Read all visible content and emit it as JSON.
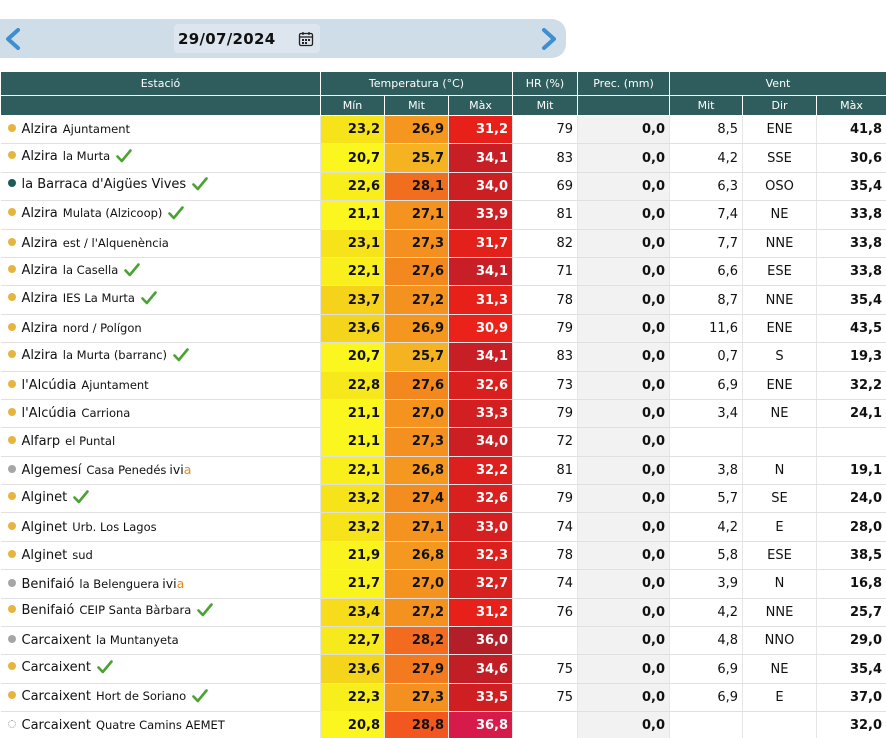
{
  "date_nav": {
    "date": "29/07/2024",
    "prev_icon": "chevron-left-icon",
    "next_icon": "chevron-right-icon",
    "calendar_icon": "calendar-icon"
  },
  "headers": {
    "station": "Estació",
    "temperature": "Temperatura (°C)",
    "humidity": "HR (%)",
    "precip": "Prec. (mm)",
    "wind": "Vent",
    "t_min": "Mín",
    "t_mit": "Mit",
    "t_max": "Màx",
    "hr_mit": "Mit",
    "w_mit": "Mit",
    "w_dir": "Dir",
    "w_max": "Màx"
  },
  "colors": {
    "header_bg": "#2f5d5d",
    "dot_orange": "#e8b440",
    "dot_teal": "#1e5a5a",
    "dot_gray": "#a6a6a6",
    "check_green": "#4aa233"
  },
  "rows": [
    {
      "name": "Alzira",
      "sub": "Ajuntament",
      "dot": "orange",
      "check": false,
      "ivia": false,
      "tmin": "23,2",
      "tmit": "26,9",
      "tmax": "31,2",
      "hr": "79",
      "prec": "0,0",
      "wmit": "8,5",
      "wdir": "ENE",
      "wmax": "41,8",
      "c": [
        "#f7e31a",
        "#f5961f",
        "#e8201a"
      ]
    },
    {
      "name": "Alzira",
      "sub": "la Murta",
      "dot": "orange",
      "check": true,
      "ivia": false,
      "tmin": "20,7",
      "tmit": "25,7",
      "tmax": "34,1",
      "hr": "83",
      "prec": "0,0",
      "wmit": "4,2",
      "wdir": "SSE",
      "wmax": "30,6",
      "c": [
        "#fbf71e",
        "#f6b321",
        "#c81e25"
      ]
    },
    {
      "name": "la Barraca d'Aigües Vives",
      "sub": "",
      "dot": "teal",
      "check": true,
      "ivia": false,
      "tmin": "22,6",
      "tmit": "28,1",
      "tmax": "34,0",
      "hr": "69",
      "prec": "0,0",
      "wmit": "6,3",
      "wdir": "OSO",
      "wmax": "35,4",
      "c": [
        "#f7ee1c",
        "#f26e1f",
        "#cb1f24"
      ]
    },
    {
      "name": "Alzira",
      "sub": "Mulata (Alzicoop)",
      "dot": "orange",
      "check": true,
      "ivia": false,
      "tmin": "21,1",
      "tmit": "27,1",
      "tmax": "33,9",
      "hr": "81",
      "prec": "0,0",
      "wmit": "7,4",
      "wdir": "NE",
      "wmax": "33,8",
      "c": [
        "#fbf71e",
        "#f4931f",
        "#cd1f24"
      ]
    },
    {
      "name": "Alzira",
      "sub": "est / l'Alquenència",
      "dot": "orange",
      "check": false,
      "ivia": false,
      "tmin": "23,1",
      "tmit": "27,3",
      "tmax": "31,7",
      "hr": "82",
      "prec": "0,0",
      "wmit": "7,7",
      "wdir": "NNE",
      "wmax": "33,8",
      "c": [
        "#f7e31a",
        "#f4901f",
        "#e4201b"
      ]
    },
    {
      "name": "Alzira",
      "sub": "la Casella",
      "dot": "orange",
      "check": true,
      "ivia": false,
      "tmin": "22,1",
      "tmit": "27,6",
      "tmax": "34,1",
      "hr": "71",
      "prec": "0,0",
      "wmit": "6,6",
      "wdir": "ESE",
      "wmax": "33,8",
      "c": [
        "#f8ef1c",
        "#f3881f",
        "#c81e25"
      ]
    },
    {
      "name": "Alzira",
      "sub": "IES La Murta",
      "dot": "orange",
      "check": true,
      "ivia": false,
      "tmin": "23,7",
      "tmit": "27,2",
      "tmax": "31,3",
      "hr": "78",
      "prec": "0,0",
      "wmit": "8,7",
      "wdir": "NNE",
      "wmax": "35,4",
      "c": [
        "#f5d31b",
        "#f4921f",
        "#e8201a"
      ]
    },
    {
      "name": "Alzira",
      "sub": "nord / Polígon",
      "dot": "orange",
      "check": false,
      "ivia": false,
      "tmin": "23,6",
      "tmit": "26,9",
      "tmax": "30,9",
      "hr": "79",
      "prec": "0,0",
      "wmit": "11,6",
      "wdir": "ENE",
      "wmax": "43,5",
      "c": [
        "#f5d51b",
        "#f5961f",
        "#ea221a"
      ]
    },
    {
      "name": "Alzira",
      "sub": "la Murta (barranc)",
      "dot": "orange",
      "check": true,
      "ivia": false,
      "tmin": "20,7",
      "tmit": "25,7",
      "tmax": "34,1",
      "hr": "83",
      "prec": "0,0",
      "wmit": "0,7",
      "wdir": "S",
      "wmax": "19,3",
      "c": [
        "#fbf71e",
        "#f6b321",
        "#c81e25"
      ]
    },
    {
      "name": "l'Alcúdia",
      "sub": "Ajuntament",
      "dot": "orange",
      "check": false,
      "ivia": false,
      "tmin": "22,8",
      "tmit": "27,6",
      "tmax": "32,6",
      "hr": "73",
      "prec": "0,0",
      "wmit": "6,9",
      "wdir": "ENE",
      "wmax": "32,2",
      "c": [
        "#f6e81b",
        "#f3881f",
        "#d9201e"
      ]
    },
    {
      "name": "l'Alcúdia",
      "sub": "Carriona",
      "dot": "orange",
      "check": false,
      "ivia": false,
      "tmin": "21,1",
      "tmit": "27,0",
      "tmax": "33,3",
      "hr": "79",
      "prec": "0,0",
      "wmit": "3,4",
      "wdir": "NE",
      "wmax": "24,1",
      "c": [
        "#fbf71e",
        "#f4941f",
        "#d21f22"
      ]
    },
    {
      "name": "Alfarp",
      "sub": "el Puntal",
      "dot": "orange",
      "check": false,
      "ivia": false,
      "tmin": "21,1",
      "tmit": "27,3",
      "tmax": "34,0",
      "hr": "72",
      "prec": "0,0",
      "wmit": "",
      "wdir": "",
      "wmax": "",
      "c": [
        "#fbf71e",
        "#f4901f",
        "#cb1f24"
      ]
    },
    {
      "name": "Algemesí",
      "sub": "Casa Penedés",
      "dot": "gray",
      "check": false,
      "ivia": true,
      "tmin": "22,1",
      "tmit": "26,8",
      "tmax": "32,2",
      "hr": "81",
      "prec": "0,0",
      "wmit": "3,8",
      "wdir": "N",
      "wmax": "19,1",
      "c": [
        "#f8ef1c",
        "#f5981f",
        "#dd201d"
      ]
    },
    {
      "name": "Alginet",
      "sub": "",
      "dot": "orange",
      "check": true,
      "ivia": false,
      "tmin": "23,2",
      "tmit": "27,4",
      "tmax": "32,6",
      "hr": "79",
      "prec": "0,0",
      "wmit": "5,7",
      "wdir": "SE",
      "wmax": "24,0",
      "c": [
        "#f7e31a",
        "#f38d1f",
        "#d9201e"
      ]
    },
    {
      "name": "Alginet",
      "sub": "Urb. Los Lagos",
      "dot": "orange",
      "check": false,
      "ivia": false,
      "tmin": "23,2",
      "tmit": "27,1",
      "tmax": "33,0",
      "hr": "74",
      "prec": "0,0",
      "wmit": "4,2",
      "wdir": "E",
      "wmax": "28,0",
      "c": [
        "#f7e31a",
        "#f4931f",
        "#d51f20"
      ]
    },
    {
      "name": "Alginet",
      "sub": "sud",
      "dot": "orange",
      "check": false,
      "ivia": false,
      "tmin": "21,9",
      "tmit": "26,8",
      "tmax": "32,3",
      "hr": "78",
      "prec": "0,0",
      "wmit": "5,8",
      "wdir": "ESE",
      "wmax": "38,5",
      "c": [
        "#faf31d",
        "#f5981f",
        "#dc201d"
      ]
    },
    {
      "name": "Benifaió",
      "sub": "la Belenguera",
      "dot": "gray",
      "check": false,
      "ivia": true,
      "tmin": "21,7",
      "tmit": "27,0",
      "tmax": "32,7",
      "hr": "74",
      "prec": "0,0",
      "wmit": "3,9",
      "wdir": "N",
      "wmax": "16,8",
      "c": [
        "#faf41d",
        "#f4941f",
        "#d8201e"
      ]
    },
    {
      "name": "Benifaió",
      "sub": "CEIP Santa Bàrbara",
      "dot": "orange",
      "check": true,
      "ivia": false,
      "tmin": "23,4",
      "tmit": "27,2",
      "tmax": "31,2",
      "hr": "76",
      "prec": "0,0",
      "wmit": "4,2",
      "wdir": "NNE",
      "wmax": "25,7",
      "c": [
        "#f6dc1b",
        "#f4921f",
        "#e8201a"
      ]
    },
    {
      "name": "Carcaixent",
      "sub": "la Muntanyeta",
      "dot": "gray",
      "check": false,
      "ivia": false,
      "tmin": "22,7",
      "tmit": "28,2",
      "tmax": "36,0",
      "hr": "",
      "prec": "0,0",
      "wmit": "4,8",
      "wdir": "NNO",
      "wmax": "29,0",
      "c": [
        "#f6ea1c",
        "#f26b1f",
        "#b41e28"
      ]
    },
    {
      "name": "Carcaixent",
      "sub": "",
      "dot": "orange",
      "check": true,
      "ivia": false,
      "tmin": "23,6",
      "tmit": "27,9",
      "tmax": "34,6",
      "hr": "75",
      "prec": "0,0",
      "wmit": "6,9",
      "wdir": "NE",
      "wmax": "35,4",
      "c": [
        "#f5d51b",
        "#f37a1f",
        "#c21e26"
      ]
    },
    {
      "name": "Carcaixent",
      "sub": "Hort de Soriano",
      "dot": "orange",
      "check": true,
      "ivia": false,
      "tmin": "22,3",
      "tmit": "27,3",
      "tmax": "33,5",
      "hr": "75",
      "prec": "0,0",
      "wmit": "6,9",
      "wdir": "E",
      "wmax": "37,0",
      "c": [
        "#f7ee1c",
        "#f4901f",
        "#d01f23"
      ]
    },
    {
      "name": "Carcaixent",
      "sub": "Quatre Camins AEMET",
      "dot": "hollow",
      "check": false,
      "ivia": false,
      "tmin": "20,8",
      "tmit": "28,8",
      "tmax": "36,8",
      "hr": "",
      "prec": "0,0",
      "wmit": "",
      "wdir": "",
      "wmax": "32,0",
      "c": [
        "#fbf71e",
        "#f2571f",
        "#d61a4a"
      ]
    }
  ]
}
